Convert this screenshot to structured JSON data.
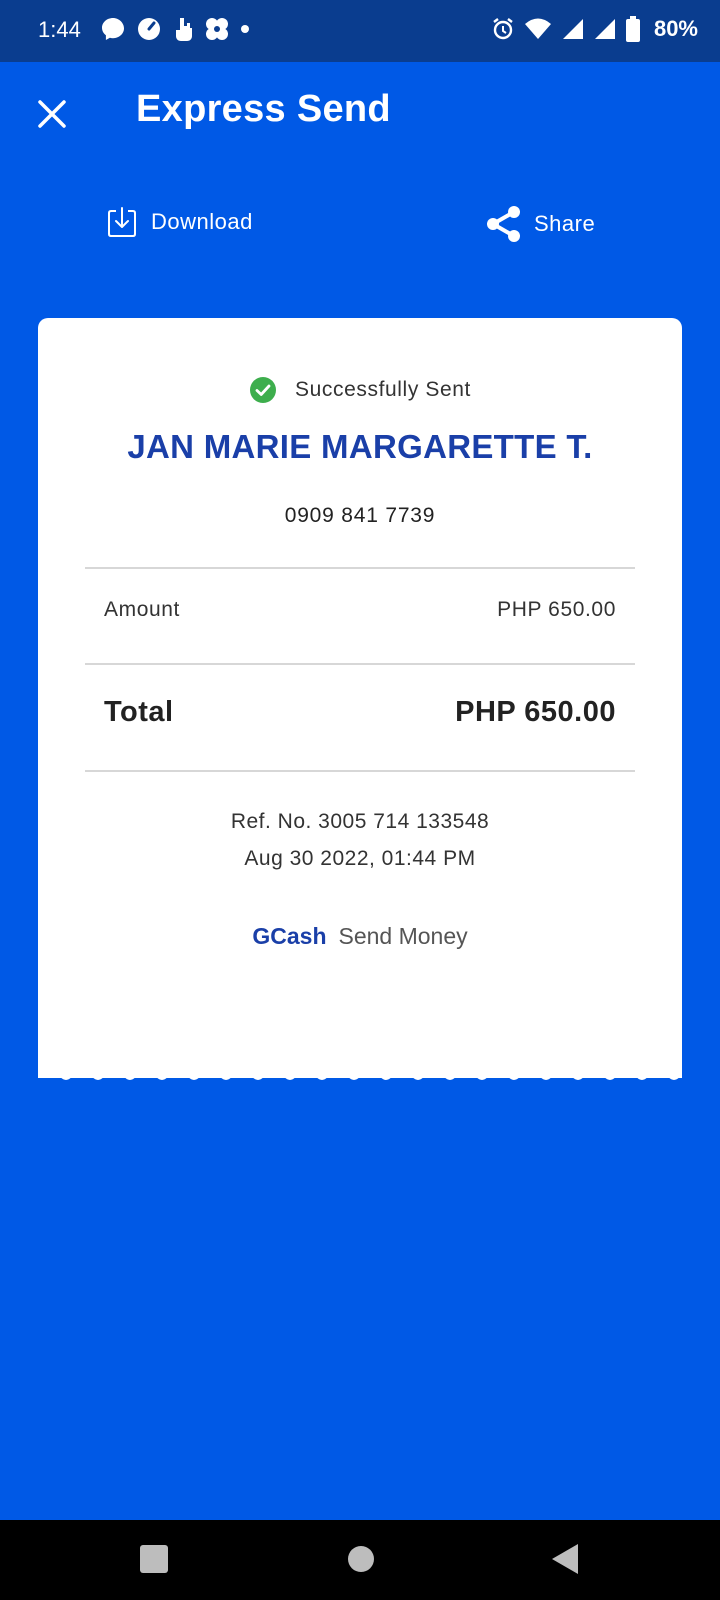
{
  "status_bar": {
    "time": "1:44",
    "battery": "80%",
    "left_icons": [
      "messenger-icon",
      "speedometer-icon",
      "gesture-icon",
      "pinwheel-icon",
      "notification-dot-icon"
    ],
    "right_icons": [
      "alarm-icon",
      "wifi-icon",
      "signal-icon",
      "signal-icon",
      "battery-icon"
    ],
    "background": "#0A3D8F"
  },
  "header": {
    "title": "Express Send",
    "close_icon": "close-icon"
  },
  "actions": {
    "download_label": "Download",
    "share_label": "Share"
  },
  "receipt": {
    "status_text": "Successfully Sent",
    "recipient_name": "JAN MARIE MARGARETTE T.",
    "recipient_phone": "0909 841 7739",
    "amount_label": "Amount",
    "amount_value": "PHP 650.00",
    "total_label": "Total",
    "total_value": "PHP 650.00",
    "ref_no": "Ref. No. 3005 714 133548",
    "datetime": "Aug 30 2022, 01:44 PM",
    "brand": "GCash",
    "service": "Send Money"
  },
  "colors": {
    "background": "#0059E6",
    "brand_blue": "#1A3FA8",
    "success_green": "#3DAE4D"
  }
}
